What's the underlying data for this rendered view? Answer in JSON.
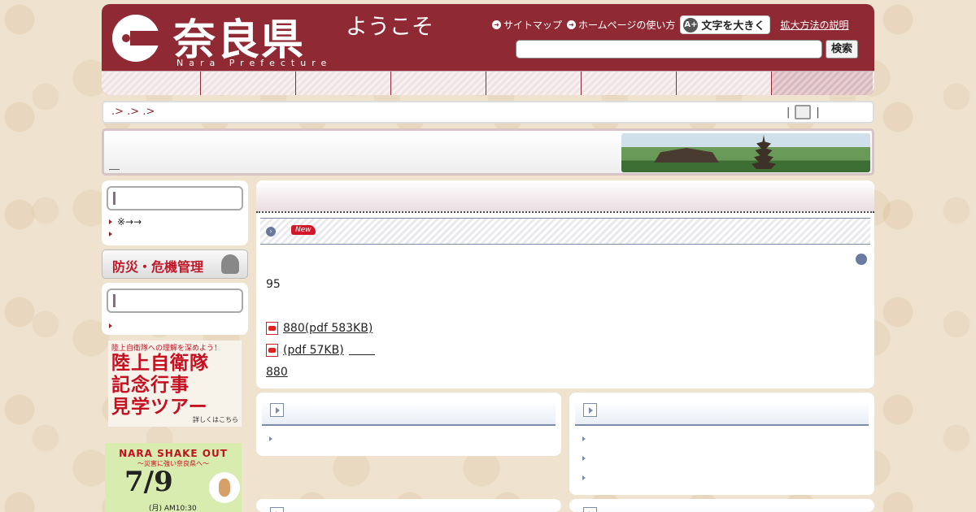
{
  "header": {
    "logo_kanji": "奈良県",
    "logo_roman": "Nara Prefecture",
    "welcome": "ようこそ",
    "links": {
      "sitemap": "サイトマップ",
      "howto": "ホームページの使い方",
      "bigtext": "文字を大きく",
      "bigtext_icon": "A+",
      "explain": "拡大方法の説明"
    },
    "search": {
      "value": "",
      "button": "検索"
    }
  },
  "breadcrumb": {
    "text": ".> .> .>",
    "print_left": "|",
    "print_right": "|"
  },
  "sidebar": {
    "box1_items": [
      "※→→",
      ""
    ],
    "bousai_title": "防災・危機管理",
    "box2_items": [
      ""
    ],
    "ad1": {
      "small": "陸上自衛隊への理解を深めよう！",
      "line1": "陸上自衛隊",
      "line2": "記念行事",
      "line3": "見学ツアー",
      "more": "詳しくはこちら"
    },
    "ad2": {
      "title": "NARA SHAKE OUT",
      "subtitle": "〜災害に強い奈良県へ〜",
      "date": "7/9",
      "time": "(月) AM10:30"
    }
  },
  "main": {
    "new_badge": "New",
    "text_95": "95",
    "pdf1": "880(pdf 583KB)",
    "pdf2": "(pdf 57KB)",
    "link_880": "880"
  },
  "colors": {
    "header_bg": "#8f2a35",
    "accent_red": "#c01828",
    "nav_blue": "#7c8ca8"
  }
}
